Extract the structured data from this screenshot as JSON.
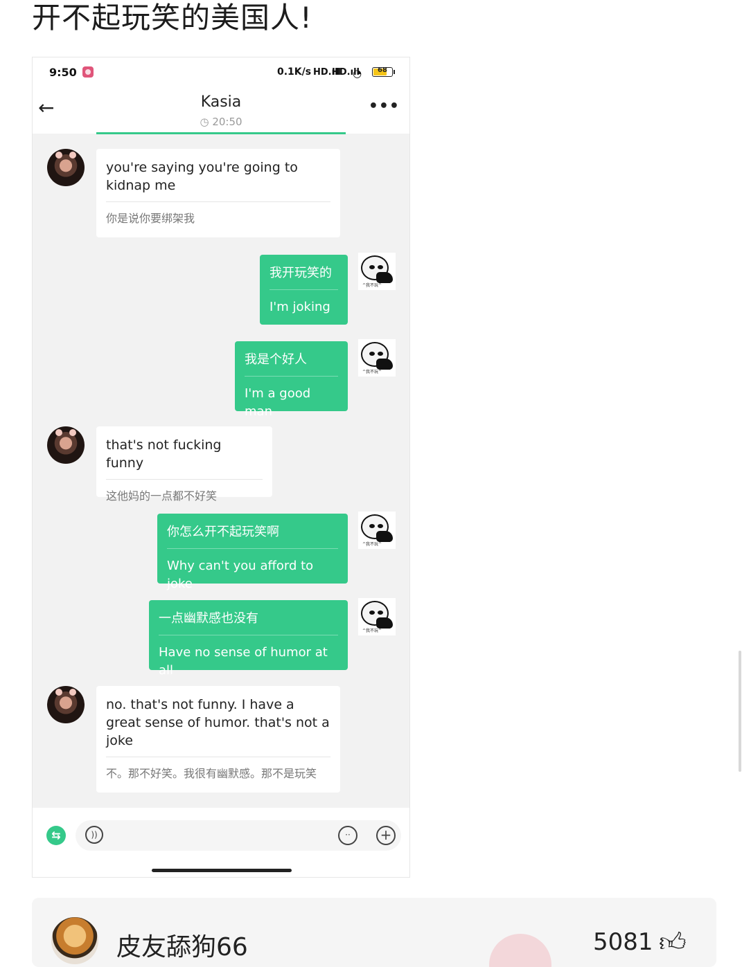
{
  "post": {
    "title": "开不起玩笑的美国人!"
  },
  "status_bar": {
    "time": "9:50",
    "network_speed": "0.1K/s",
    "signal1": "HD.ıll",
    "signal2": "HD.ıll",
    "wifi": "wifi",
    "battery": "68"
  },
  "chat_header": {
    "contact_name": "Kasia",
    "time": "20:50"
  },
  "messages": [
    {
      "side": "left",
      "original": "you're saying you're going to kidnap me",
      "translation": "你是说你要绑架我"
    },
    {
      "side": "right",
      "original": "我开玩笑的",
      "translation": "I'm joking"
    },
    {
      "side": "right",
      "original": "我是个好人",
      "translation": "I'm a good man"
    },
    {
      "side": "left",
      "original": "that's not fucking funny",
      "translation": "这他妈的一点都不好笑"
    },
    {
      "side": "right",
      "original": "你怎么开不起玩笑啊",
      "translation": "Why can't you afford to joke"
    },
    {
      "side": "right",
      "original": "一点幽默感也没有",
      "translation": "Have no sense of humor at all"
    },
    {
      "side": "left",
      "original": "no. that's not funny. I have a great sense of humor. that's not a joke",
      "translation": "不。那不好笑。我很有幽默感。那不是玩笑"
    }
  ],
  "sticker_caption": "^我不玩^",
  "comment": {
    "username": "皮友舔狗66",
    "likes": "5081"
  },
  "colors": {
    "accent_green": "#35c98a",
    "chat_bg": "#f2f2f2"
  },
  "icons": [
    "back-arrow-icon",
    "more-icon",
    "clock-icon",
    "translate-switch-icon",
    "voice-icon",
    "emoji-icon",
    "plus-icon",
    "thumbs-up-icon"
  ]
}
